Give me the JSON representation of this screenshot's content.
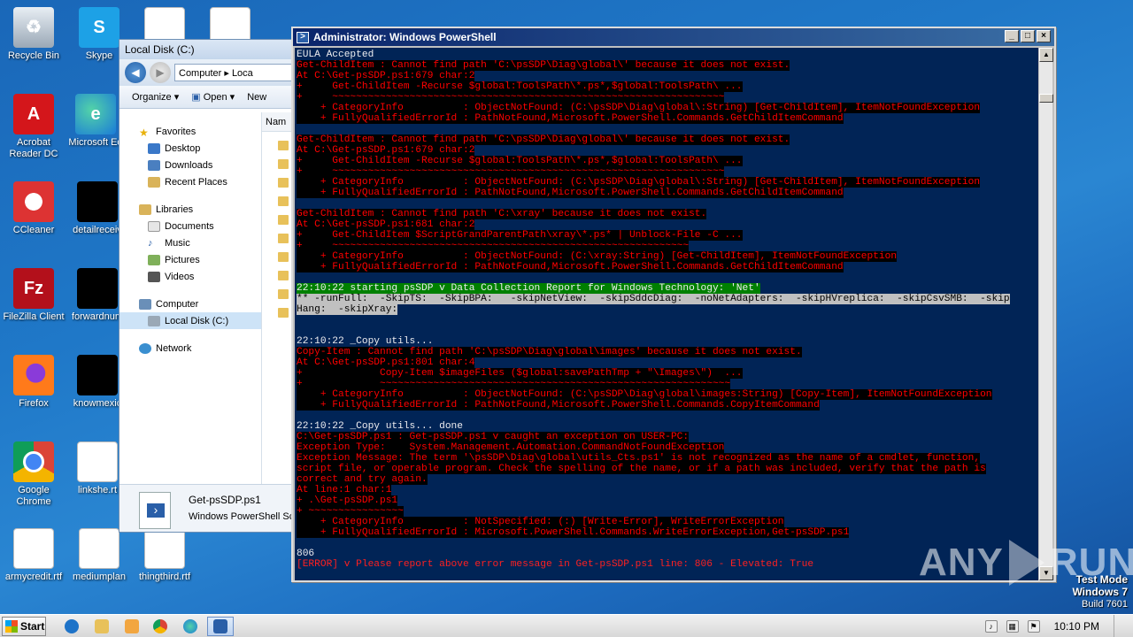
{
  "desktop": {
    "icons": [
      {
        "label": "Recycle Bin",
        "icon": "recycle-bin-icon"
      },
      {
        "label": "Skype",
        "icon": "skype-icon"
      },
      {
        "label": "",
        "icon": "word-doc-icon"
      },
      {
        "label": "",
        "icon": "word-doc-icon"
      },
      {
        "label": "Acrobat Reader DC",
        "icon": "acrobat-icon"
      },
      {
        "label": "Microsoft Ed",
        "icon": "edge-icon"
      },
      {
        "label": "CCleaner",
        "icon": "ccleaner-icon"
      },
      {
        "label": "detailreceiv",
        "icon": "black-file-icon"
      },
      {
        "label": "FileZilla Client",
        "icon": "filezilla-icon"
      },
      {
        "label": "forwardnum",
        "icon": "black-file-icon"
      },
      {
        "label": "Firefox",
        "icon": "firefox-icon"
      },
      {
        "label": "knowmexic",
        "icon": "black-file-icon"
      },
      {
        "label": "Google Chrome",
        "icon": "chrome-icon"
      },
      {
        "label": "linkshe.rt",
        "icon": "word-doc-icon"
      },
      {
        "label": "armycredit.rtf",
        "icon": "word-doc-icon"
      },
      {
        "label": "mediumplan",
        "icon": "word-doc-icon"
      },
      {
        "label": "thingthird.rtf",
        "icon": "word-doc-icon"
      }
    ]
  },
  "explorer": {
    "title": "Local Disk (C:)",
    "address": [
      "Computer",
      "Loca"
    ],
    "toolbar": {
      "organize": "Organize",
      "open": "Open",
      "new": "New"
    },
    "column_header": "Nam",
    "nav": {
      "favorites": "Favorites",
      "desktop": "Desktop",
      "downloads": "Downloads",
      "recent": "Recent Places",
      "libraries": "Libraries",
      "documents": "Documents",
      "music": "Music",
      "pictures": "Pictures",
      "videos": "Videos",
      "computer": "Computer",
      "local_disk": "Local Disk (C:)",
      "network": "Network"
    },
    "details": {
      "filename": "Get-psSDP.ps1",
      "filetype": "Windows PowerShell Scri"
    }
  },
  "powershell": {
    "title": "Administrator: Windows PowerShell",
    "lines": [
      {
        "t": "EULA Accepted",
        "s": "w"
      },
      {
        "t": "Get-ChildItem : Cannot find path 'C:\\psSDP\\Diag\\global\\' because it does not exist.",
        "s": "e"
      },
      {
        "t": "At C:\\Get-psSDP.ps1:679 char:2",
        "s": "e"
      },
      {
        "t": "+     Get-ChildItem -Recurse $global:ToolsPath\\*.ps*,$global:ToolsPath\\ ...",
        "s": "e"
      },
      {
        "t": "+     ~~~~~~~~~~~~~~~~~~~~~~~~~~~~~~~~~~~~~~~~~~~~~~~~~~~~~~~~~~~~~~~~~~",
        "s": "e"
      },
      {
        "t": "    + CategoryInfo          : ObjectNotFound: (C:\\psSDP\\Diag\\global\\:String) [Get-ChildItem], ItemNotFoundException",
        "s": "e"
      },
      {
        "t": "    + FullyQualifiedErrorId : PathNotFound,Microsoft.PowerShell.Commands.GetChildItemCommand",
        "s": "e"
      },
      {
        "t": "",
        "s": "w"
      },
      {
        "t": "Get-ChildItem : Cannot find path 'C:\\psSDP\\Diag\\global\\' because it does not exist.",
        "s": "e"
      },
      {
        "t": "At C:\\Get-psSDP.ps1:679 char:2",
        "s": "e"
      },
      {
        "t": "+     Get-ChildItem -Recurse $global:ToolsPath\\*.ps*,$global:ToolsPath\\ ...",
        "s": "e"
      },
      {
        "t": "+     ~~~~~~~~~~~~~~~~~~~~~~~~~~~~~~~~~~~~~~~~~~~~~~~~~~~~~~~~~~~~~~~~~~",
        "s": "e"
      },
      {
        "t": "    + CategoryInfo          : ObjectNotFound: (C:\\psSDP\\Diag\\global\\:String) [Get-ChildItem], ItemNotFoundException",
        "s": "e"
      },
      {
        "t": "    + FullyQualifiedErrorId : PathNotFound,Microsoft.PowerShell.Commands.GetChildItemCommand",
        "s": "e"
      },
      {
        "t": "",
        "s": "w"
      },
      {
        "t": "Get-ChildItem : Cannot find path 'C:\\xray' because it does not exist.",
        "s": "e"
      },
      {
        "t": "At C:\\Get-psSDP.ps1:681 char:2",
        "s": "e"
      },
      {
        "t": "+     Get-ChildItem $ScriptGrandParentPath\\xray\\*.ps* | Unblock-File -C ...",
        "s": "e"
      },
      {
        "t": "+     ~~~~~~~~~~~~~~~~~~~~~~~~~~~~~~~~~~~~~~~~~~~~~~~~~~~~~~~~~~~~",
        "s": "e"
      },
      {
        "t": "    + CategoryInfo          : ObjectNotFound: (C:\\xray:String) [Get-ChildItem], ItemNotFoundException",
        "s": "e"
      },
      {
        "t": "    + FullyQualifiedErrorId : PathNotFound,Microsoft.PowerShell.Commands.GetChildItemCommand",
        "s": "e"
      },
      {
        "t": "",
        "s": "w"
      },
      {
        "t": "22:10:22 starting psSDP v Data Collection Report for Windows Technology: 'Net'",
        "s": "g"
      },
      {
        "t": "** -runFull:  -SkipTS:  -SkipBPA:   -skipNetView:  -skipSddcDiag:  -noNetAdapters:  -skipHVreplica:  -skipCsvSMB:  -skip",
        "s": "sel"
      },
      {
        "t": "Hang:  -skipXray:",
        "s": "sel"
      },
      {
        "t": "",
        "s": "w"
      },
      {
        "t": "",
        "s": "w"
      },
      {
        "t": "22:10:22 _Copy utils...",
        "s": "w"
      },
      {
        "t": "Copy-Item : Cannot find path 'C:\\psSDP\\Diag\\global\\images' because it does not exist.",
        "s": "e"
      },
      {
        "t": "At C:\\Get-psSDP.ps1:801 char:4",
        "s": "e"
      },
      {
        "t": "+             Copy-Item $imageFiles ($global:savePathTmp + \"\\Images\\\")  ...",
        "s": "e"
      },
      {
        "t": "+             ~~~~~~~~~~~~~~~~~~~~~~~~~~~~~~~~~~~~~~~~~~~~~~~~~~~~~~~~~~~",
        "s": "e"
      },
      {
        "t": "    + CategoryInfo          : ObjectNotFound: (C:\\psSDP\\Diag\\global\\images:String) [Copy-Item], ItemNotFoundException",
        "s": "e"
      },
      {
        "t": "    + FullyQualifiedErrorId : PathNotFound,Microsoft.PowerShell.Commands.CopyItemCommand",
        "s": "e"
      },
      {
        "t": "",
        "s": "w"
      },
      {
        "t": "22:10:22 _Copy utils... done",
        "s": "w"
      },
      {
        "t": "C:\\Get-psSDP.ps1 : Get-psSDP.ps1 v caught an exception on USER-PC:",
        "s": "e"
      },
      {
        "t": "Exception Type:    System.Management.Automation.CommandNotFoundException",
        "s": "e"
      },
      {
        "t": "Exception Message: The term '\\psSDP\\Diag\\global\\utils_Cts.ps1' is not recognized as the name of a cmdlet, function,",
        "s": "e"
      },
      {
        "t": "script file, or operable program. Check the spelling of the name, or if a path was included, verify that the path is",
        "s": "e"
      },
      {
        "t": "correct and try again.",
        "s": "e"
      },
      {
        "t": "At line:1 char:1",
        "s": "e"
      },
      {
        "t": "+ .\\Get-psSDP.ps1",
        "s": "e"
      },
      {
        "t": "+ ~~~~~~~~~~~~~~~~",
        "s": "e"
      },
      {
        "t": "    + CategoryInfo          : NotSpecified: (:) [Write-Error], WriteErrorException",
        "s": "e"
      },
      {
        "t": "    + FullyQualifiedErrorId : Microsoft.PowerShell.Commands.WriteErrorException,Get-psSDP.ps1",
        "s": "e"
      },
      {
        "t": "",
        "s": "w"
      },
      {
        "t": "806",
        "s": "w"
      },
      {
        "t": "[ERROR] v Please report above error message in Get-psSDP.ps1 line: 806 - Elevated: True",
        "s": "errln"
      }
    ]
  },
  "watermark": {
    "left": "ANY",
    "right": "RUN"
  },
  "testmode": {
    "line1": "Test Mode",
    "line2": "Windows 7",
    "line3": "Build 7601"
  },
  "taskbar": {
    "start_label": "Start",
    "clock": "10:10 PM",
    "apps": [
      "ie-icon",
      "explorer-icon",
      "media-player-icon",
      "chrome-icon",
      "edge-icon",
      "powershell-icon"
    ]
  },
  "colors": {
    "ps_background": "#012456",
    "error_red": "#ff0000",
    "highlight_green": "#008000",
    "desktop_blue": "#1f78c8"
  }
}
